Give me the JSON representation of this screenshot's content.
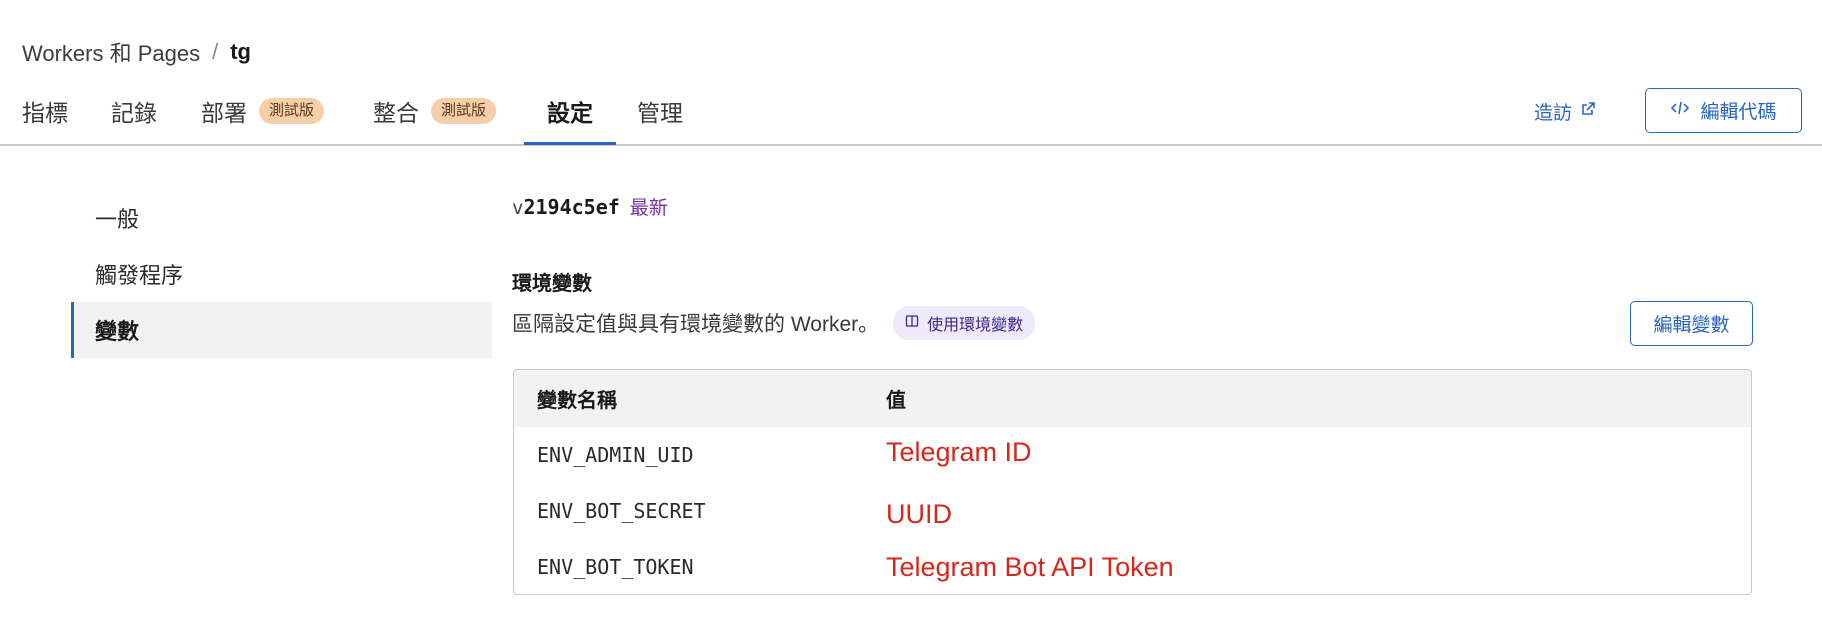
{
  "breadcrumb": {
    "parent": "Workers 和 Pages",
    "separator": "/",
    "current": "tg"
  },
  "tabs": [
    {
      "label": "指標",
      "badge": ""
    },
    {
      "label": "記錄",
      "badge": ""
    },
    {
      "label": "部署",
      "badge": "測試版"
    },
    {
      "label": "整合",
      "badge": "測試版"
    },
    {
      "label": "設定",
      "badge": ""
    },
    {
      "label": "管理",
      "badge": ""
    }
  ],
  "active_tab": "設定",
  "header_actions": {
    "visit_label": "造訪",
    "edit_code_label": "編輯代碼"
  },
  "sidebar": {
    "items": [
      {
        "label": "一般"
      },
      {
        "label": "觸發程序"
      },
      {
        "label": "變數"
      }
    ],
    "active": "變數"
  },
  "version": {
    "prefix": "v",
    "hash": "2194c5ef",
    "tag": "最新"
  },
  "env_section": {
    "title": "環境變數",
    "description": "區隔設定值與具有環境變數的 Worker。",
    "doc_chip_label": "使用環境變數",
    "edit_button_label": "編輯變數"
  },
  "vars_table": {
    "headers": {
      "name": "變數名稱",
      "value": "值"
    },
    "rows": [
      {
        "name": "ENV_ADMIN_UID",
        "value": "Telegram ID"
      },
      {
        "name": "ENV_BOT_SECRET",
        "value": "UUID"
      },
      {
        "name": "ENV_BOT_TOKEN",
        "value": "Telegram Bot API Token"
      }
    ]
  },
  "colors": {
    "accent": "#2a64c5",
    "badge_bg": "#f6cfa8",
    "latest": "#7a2ea8",
    "value_annotation": "#d8261c"
  },
  "icons": {
    "visit": "external-link-icon",
    "edit_code": "code-icon",
    "doc_chip": "book-icon"
  }
}
